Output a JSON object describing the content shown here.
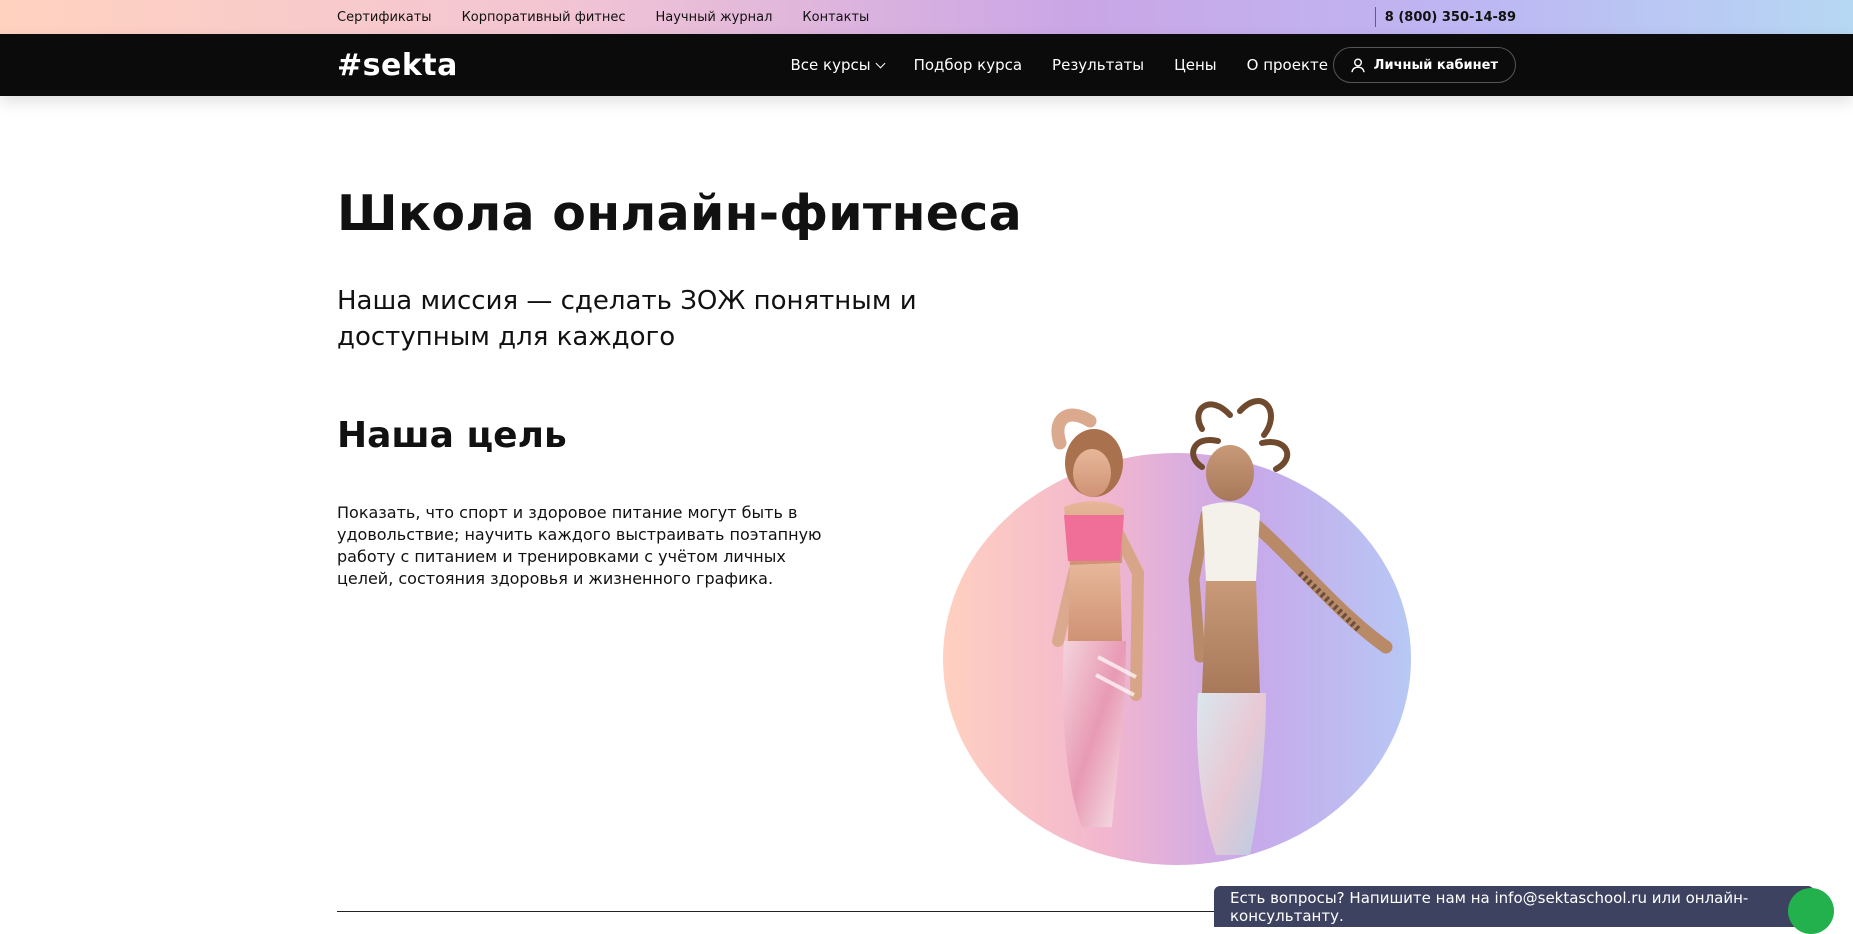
{
  "topbar": {
    "links": [
      "Сертификаты",
      "Корпоративный фитнес",
      "Научный журнал",
      "Контакты"
    ],
    "phone": "8 (800) 350-14-89"
  },
  "nav": {
    "logo": "#sekta",
    "items": [
      "Все курсы",
      "Подбор курса",
      "Результаты",
      "Цены",
      "О проекте"
    ],
    "account_label": "Личный кабинет"
  },
  "hero": {
    "title": "Школа онлайн-фитнеса",
    "mission": "Наша миссия — сделать ЗОЖ понятным и доступным для каждого",
    "goal_title": "Наша цель",
    "goal_text": "Показать, что спорт и здоровое питание могут быть в удовольствие; научить каждого выстраивать поэтапную работу с питанием и тренировками с учётом личных целей, состояния здоровья и жизненного графика."
  },
  "chat": {
    "text": "Есть вопросы? Напишите нам на info@sektaschool.ru или онлайн-консультанту."
  },
  "colors": {
    "nav_bg": "#0b0b0b",
    "chat_bg": "#3c4260",
    "chat_accent": "#22b14c"
  },
  "icons": [
    "user-icon",
    "chevron-down-icon"
  ]
}
